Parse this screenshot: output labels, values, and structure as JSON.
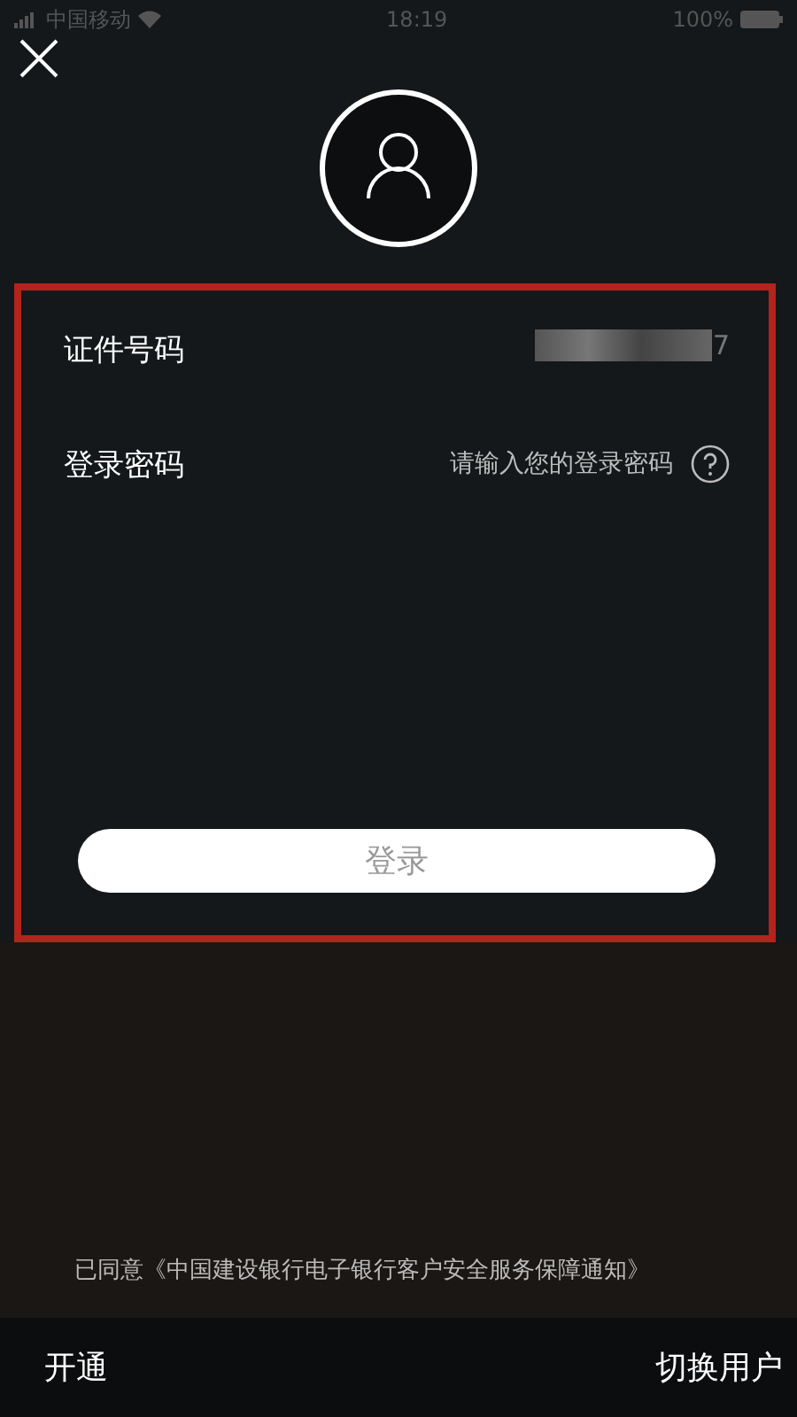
{
  "status_bar": {
    "carrier": "中国移动",
    "time": "18:19",
    "battery": "100%"
  },
  "login_form": {
    "highlight": true,
    "fields": [
      {
        "label": "证件号码",
        "value": "7",
        "masked": true
      },
      {
        "label": "登录密码",
        "placeholder": "请输入您的登录密码",
        "help": true
      }
    ],
    "submit": {
      "label": "登录",
      "disabled": true
    }
  },
  "agreement": "已同意《中国建设银行电子银行客户安全服务保障通知》",
  "bottom_bar": {
    "left": "开通",
    "right": "切换用户"
  }
}
